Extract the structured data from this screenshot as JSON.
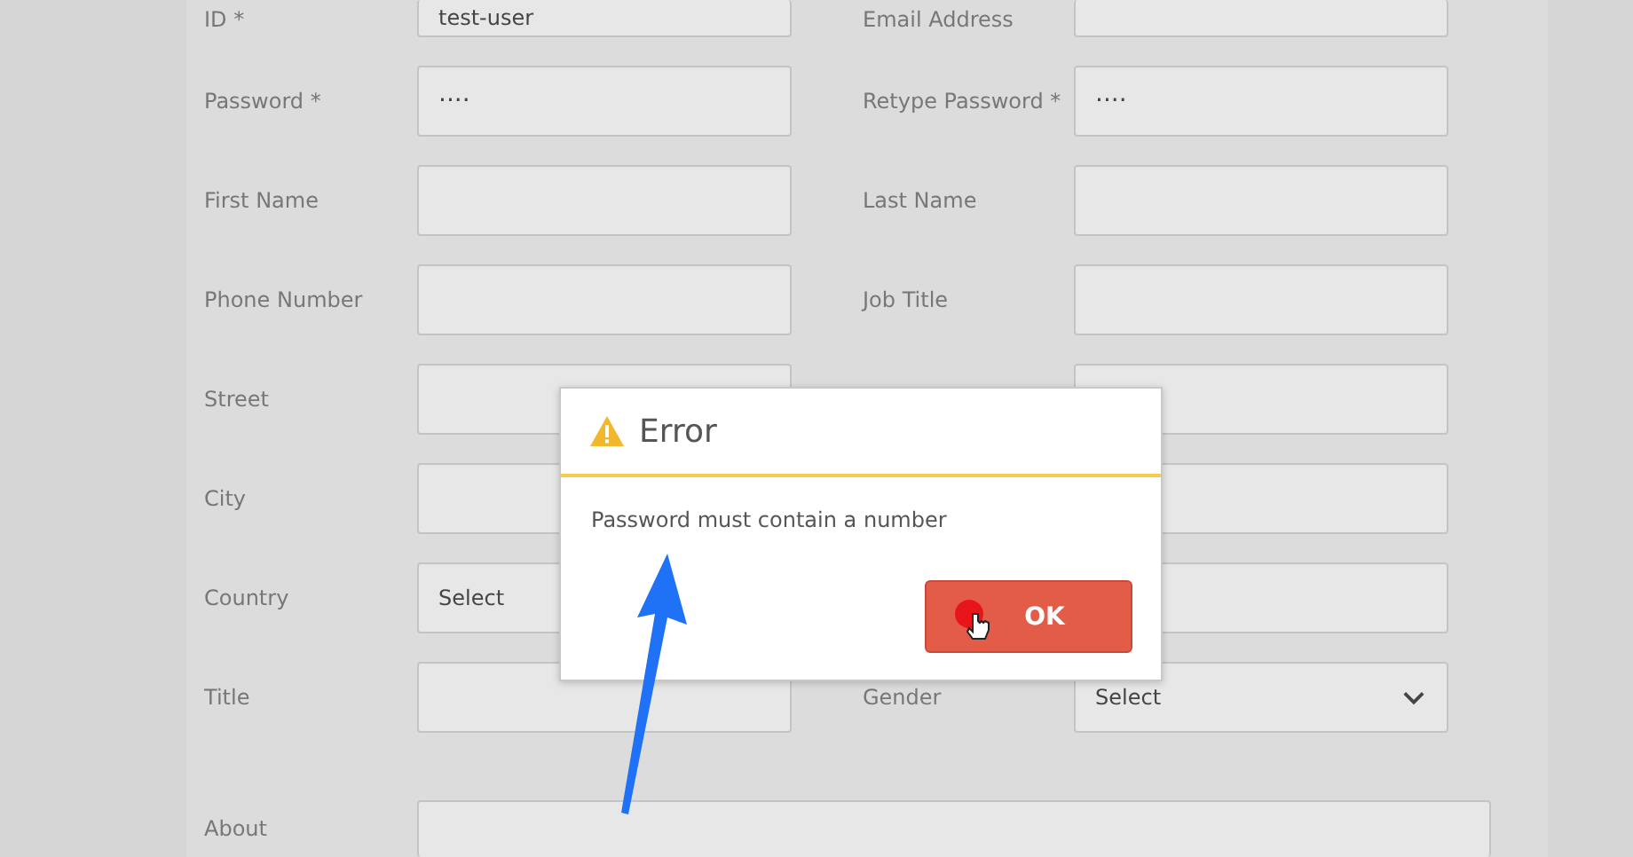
{
  "form": {
    "rows": [
      {
        "left": {
          "label": "ID *",
          "kind": "text",
          "value": "test-user"
        },
        "right": {
          "label": "Email Address",
          "kind": "text"
        }
      },
      {
        "left": {
          "label": "Password *",
          "kind": "password",
          "value": "····"
        },
        "right": {
          "label": "Retype Password *",
          "kind": "password",
          "value": "····"
        }
      },
      {
        "left": {
          "label": "First Name",
          "kind": "text"
        },
        "right": {
          "label": "Last Name",
          "kind": "text"
        }
      },
      {
        "left": {
          "label": "Phone Number",
          "kind": "text"
        },
        "right": {
          "label": "Job Title",
          "kind": "text"
        }
      },
      {
        "left": {
          "label": "Street",
          "kind": "text"
        },
        "right": {
          "kind": "text"
        }
      },
      {
        "left": {
          "label": "City",
          "kind": "text"
        },
        "right": {
          "kind": "text"
        }
      },
      {
        "left": {
          "label": "Country",
          "kind": "select",
          "value": "Select"
        },
        "right": {
          "kind": "text"
        }
      },
      {
        "left": {
          "label": "Title",
          "kind": "text"
        },
        "right": {
          "label": "Gender",
          "kind": "select",
          "value": "Select"
        }
      },
      {
        "left": {
          "label": "About",
          "kind": "textarea"
        }
      }
    ]
  },
  "dialog": {
    "title": "Error",
    "message": "Password must contain a number",
    "button": "OK"
  }
}
